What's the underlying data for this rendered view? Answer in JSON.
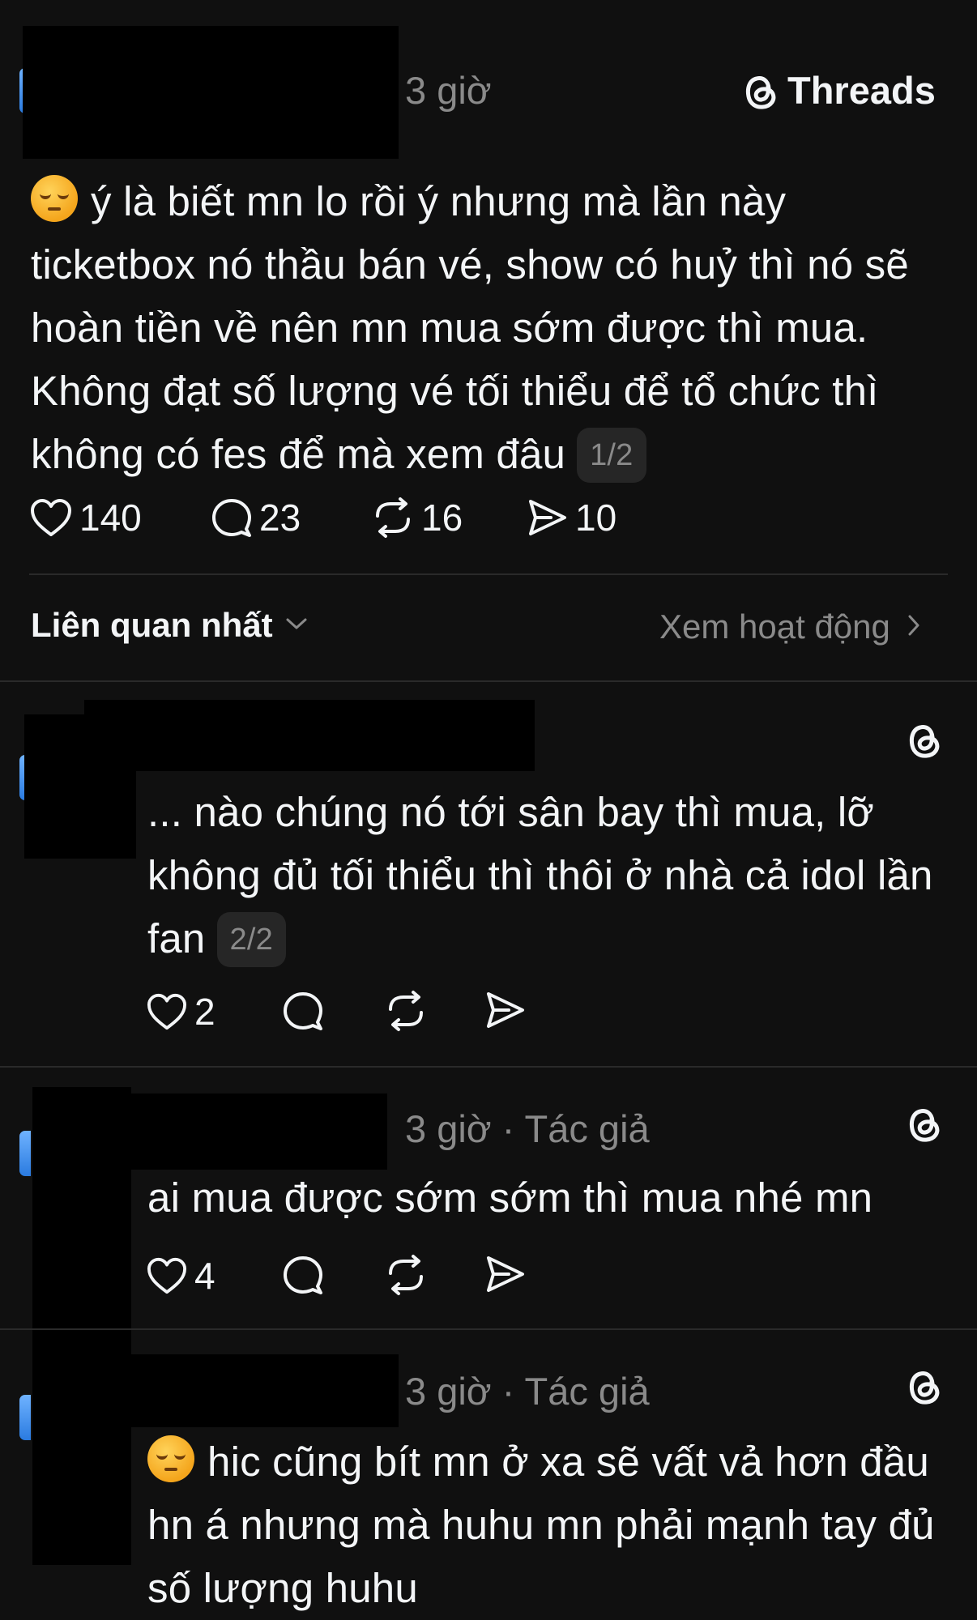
{
  "main_post": {
    "time": "3 giờ",
    "brand": "Threads",
    "text": "ý là biết mn lo rồi ý nhưng mà lần này ticketbox nó thầu bán vé, show có huỷ thì nó sẽ hoàn tiền về nên mn mua sớm được thì mua. Không đạt số lượng vé tối thiểu để tổ chức thì không có fes để mà xem đâu",
    "page_badge": "1/2",
    "likes": "140",
    "replies": "23",
    "reposts": "16",
    "shares": "10"
  },
  "sort_bar": {
    "sort_label": "Liên quan nhất",
    "activity_label": "Xem hoạt động"
  },
  "replies": [
    {
      "text": "... nào chúng nó tới sân bay thì mua, lỡ không đủ tối thiểu thì thôi ở nhà cả idol lần fan",
      "page_badge": "2/2",
      "likes": "2"
    },
    {
      "meta": "3 giờ · Tác giả",
      "text": "ai mua được sớm sớm thì mua nhé mn",
      "likes": "4"
    },
    {
      "meta": "3 giờ · Tác giả",
      "text": "hic cũng bít mn ở xa sẽ vất vả hơn đầu hn á nhưng mà huhu mn phải mạnh tay đủ số lượng huhu"
    }
  ],
  "colors": {
    "background": "#101010",
    "text": "#f3f5f7",
    "muted": "#8a8a8a",
    "divider": "#2a2a2a"
  }
}
